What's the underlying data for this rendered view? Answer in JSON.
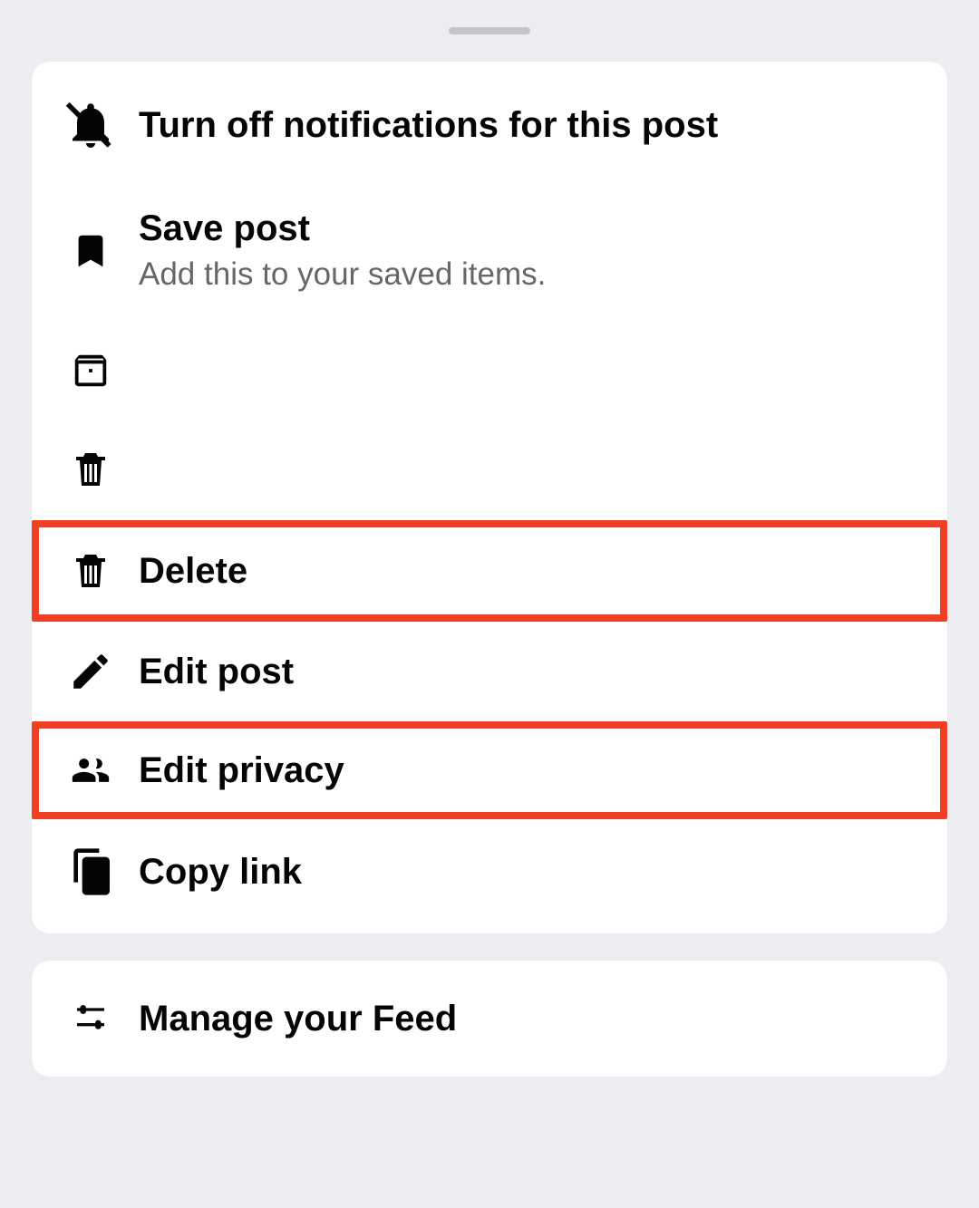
{
  "menu": {
    "items": [
      {
        "title": "Turn off notifications for this post",
        "subtitle": ""
      },
      {
        "title": "Save post",
        "subtitle": "Add this to your saved items."
      },
      {
        "title": "",
        "subtitle": ""
      },
      {
        "title": "",
        "subtitle": ""
      },
      {
        "title": "Delete",
        "subtitle": ""
      },
      {
        "title": "Edit post",
        "subtitle": ""
      },
      {
        "title": "Edit privacy",
        "subtitle": ""
      },
      {
        "title": "Copy link",
        "subtitle": ""
      }
    ],
    "secondary": [
      {
        "title": "Manage your Feed",
        "subtitle": ""
      }
    ]
  },
  "annotation": {
    "highlight_color": "#ef4023"
  }
}
